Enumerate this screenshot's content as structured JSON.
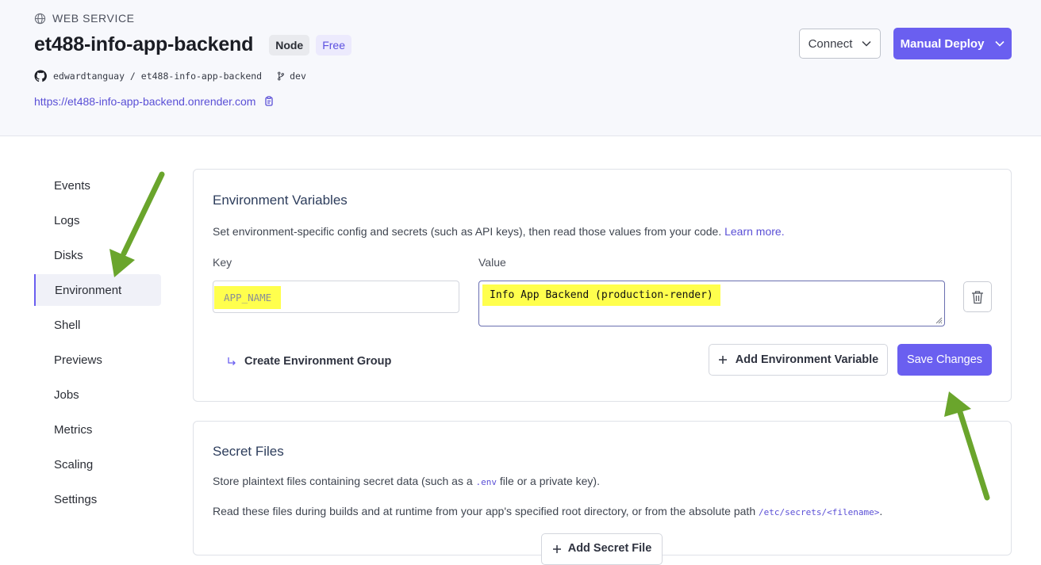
{
  "header": {
    "service_type": "WEB SERVICE",
    "service_name": "et488-info-app-backend",
    "badges": [
      "Node",
      "Free"
    ],
    "repo": "edwardtanguay / et488-info-app-backend",
    "branch": "dev",
    "url": "https://et488-info-app-backend.onrender.com",
    "connect_label": "Connect",
    "deploy_label": "Manual Deploy"
  },
  "sidebar": {
    "items": [
      {
        "label": "Events"
      },
      {
        "label": "Logs"
      },
      {
        "label": "Disks"
      },
      {
        "label": "Environment",
        "active": true
      },
      {
        "label": "Shell"
      },
      {
        "label": "Previews"
      },
      {
        "label": "Jobs"
      },
      {
        "label": "Metrics"
      },
      {
        "label": "Scaling"
      },
      {
        "label": "Settings"
      }
    ]
  },
  "env": {
    "title": "Environment Variables",
    "description": "Set environment-specific config and secrets (such as API keys), then read those values from your code.",
    "learn_more": "Learn more.",
    "key_label": "Key",
    "value_label": "Value",
    "key_value": "APP_NAME",
    "value_value": "Info App Backend (production-render)",
    "create_group_label": "Create Environment Group",
    "add_var_label": "Add Environment Variable",
    "save_label": "Save Changes"
  },
  "secrets": {
    "title": "Secret Files",
    "desc1_pre": "Store plaintext files containing secret data (such as a",
    "desc1_code": ".env",
    "desc1_post": "file or a private key).",
    "desc2_pre": "Read these files during builds and at runtime from your app's specified root directory, or from the absolute path",
    "desc2_code": "/etc/secrets/<filename>",
    "desc2_post": ".",
    "add_file_label": "Add Secret File"
  },
  "colors": {
    "accent": "#6a5ff0",
    "highlight": "#ffff4d",
    "annotation_arrow": "#6aa52c"
  }
}
